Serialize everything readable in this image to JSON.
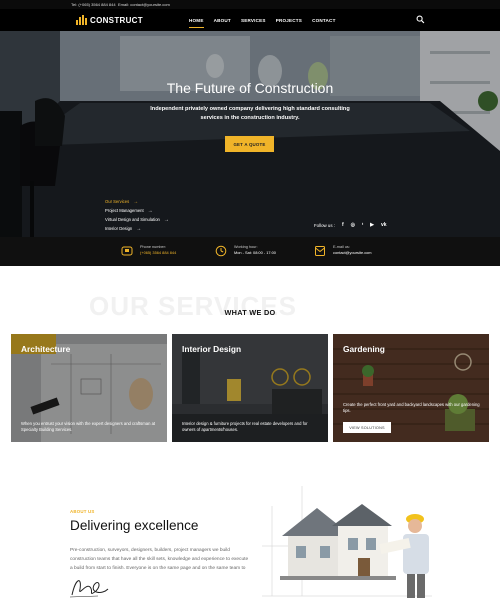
{
  "topbar": {
    "phone": "Tel: (+065) 3564 884 844",
    "email": "Email: contact@yoursite.com"
  },
  "header": {
    "logo_text": "CONSTRUCT",
    "nav": [
      "HOME",
      "ABOUT",
      "SERVICES",
      "PROJECTS",
      "CONTACT"
    ],
    "active_nav": "HOME",
    "search_icon": "search-icon"
  },
  "hero": {
    "title": "The Future of Construction",
    "subtitle": "Independent privately owned company delivering high standard consulting services in the construction industry.",
    "cta_label": "GET A QUOTE",
    "links": [
      {
        "label": "Our Services",
        "highlight": true
      },
      {
        "label": "Project Management",
        "highlight": false
      },
      {
        "label": "Virtual Design and Simulation",
        "highlight": false
      },
      {
        "label": "Interior Design",
        "highlight": false
      }
    ],
    "follow_label": "Follow us :",
    "social_icons": [
      "facebook-icon",
      "instagram-icon",
      "twitter-icon",
      "youtube-icon",
      "vk-icon"
    ]
  },
  "info_strip": {
    "phone": {
      "label": "Phone number:",
      "value": "(+065) 3564 884 844"
    },
    "hours": {
      "label": "Working hour:",
      "value": "Mon - Sat: 08:00 - 17:00"
    },
    "email": {
      "label": "E-mail us:",
      "value": "contact@yoursite.com"
    }
  },
  "services": {
    "bg_text": "OUR SERVICES",
    "title": "WHAT WE DO",
    "cards": [
      {
        "title": "Architecture",
        "text": "When you entrust your vision with the expert designers and craftsman at Specialty Building Services."
      },
      {
        "title": "Interior Design",
        "text": "Interior design & furniture projects for real estate developers and for owners of apartments/houses."
      },
      {
        "title": "Gardening",
        "text": "Create the perfect front yard and backyard landscapes with our gardening tips.",
        "button": "VIEW SOLUTIONS"
      }
    ]
  },
  "about": {
    "tag": "ABOUT US",
    "title": "Delivering excellence",
    "text": "Pre-construction, surveyors, designers, builders, project managers we build construction teams that have all the skill sets, knowledge and experience to execute a build from start to finish. Everyone is on the same page and on the same team to"
  },
  "colors": {
    "accent": "#f0b429",
    "dark": "#0b0b0b"
  }
}
